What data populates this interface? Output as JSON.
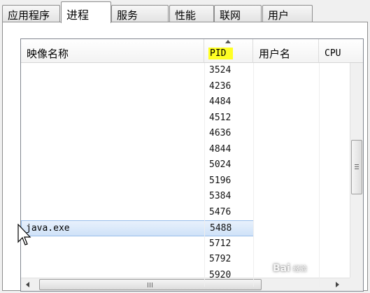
{
  "tabs": [
    {
      "label": "应用程序",
      "active": false
    },
    {
      "label": "进程",
      "active": true
    },
    {
      "label": "服务",
      "active": false
    },
    {
      "label": "性能",
      "active": false
    },
    {
      "label": "联网",
      "active": false
    },
    {
      "label": "用户",
      "active": false
    }
  ],
  "columns": {
    "image_name": "映像名称",
    "pid": "PID",
    "user_name": "用户名",
    "cpu": "CPU"
  },
  "processes": [
    {
      "name": "",
      "pid": "3524"
    },
    {
      "name": "",
      "pid": "4236"
    },
    {
      "name": "",
      "pid": "4484"
    },
    {
      "name": "",
      "pid": "4512"
    },
    {
      "name": "",
      "pid": "4636"
    },
    {
      "name": "",
      "pid": "4844"
    },
    {
      "name": "",
      "pid": "5024"
    },
    {
      "name": "",
      "pid": "5196"
    },
    {
      "name": "",
      "pid": "5384"
    },
    {
      "name": "",
      "pid": "5476"
    },
    {
      "name": "java.exe",
      "pid": "5488",
      "selected": true
    },
    {
      "name": "",
      "pid": "5712"
    },
    {
      "name": "",
      "pid": "5792"
    },
    {
      "name": "",
      "pid": "5920"
    }
  ],
  "watermark": {
    "brand": "Bai",
    "sub": "经验"
  },
  "colors": {
    "pid_highlight": "#ffff24",
    "selection": "#cfe2f8",
    "selection_border": "#98bde9"
  }
}
